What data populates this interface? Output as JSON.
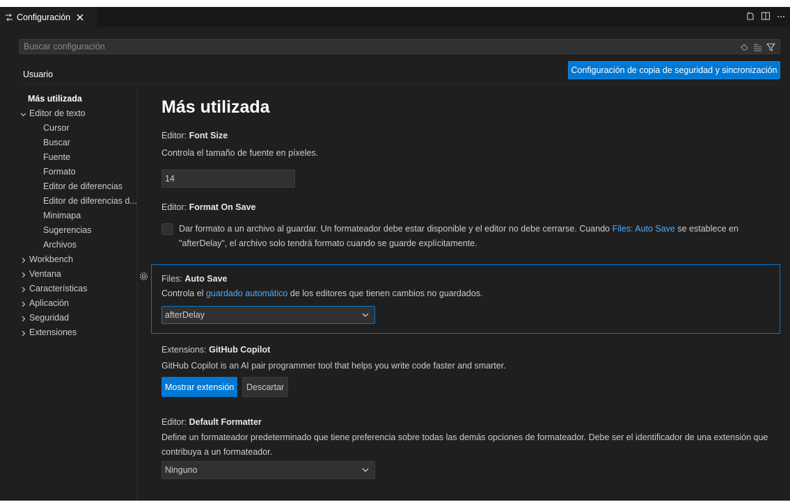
{
  "tab": {
    "title": "Configuración"
  },
  "search": {
    "placeholder": "Buscar configuración"
  },
  "scope": {
    "user": "Usuario",
    "sync_button": "Configuración de copia de seguridad y sincronización"
  },
  "toc": {
    "items": [
      {
        "label": "Más utilizada",
        "level": 0
      },
      {
        "label": "Editor de texto",
        "level": 1,
        "expanded": true
      },
      {
        "label": "Cursor",
        "level": 2
      },
      {
        "label": "Buscar",
        "level": 2
      },
      {
        "label": "Fuente",
        "level": 2
      },
      {
        "label": "Formato",
        "level": 2
      },
      {
        "label": "Editor de diferencias",
        "level": 2
      },
      {
        "label": "Editor de diferencias d...",
        "level": 2
      },
      {
        "label": "Minimapa",
        "level": 2
      },
      {
        "label": "Sugerencias",
        "level": 2
      },
      {
        "label": "Archivos",
        "level": 2
      },
      {
        "label": "Workbench",
        "level": 1,
        "expanded": false
      },
      {
        "label": "Ventana",
        "level": 1,
        "expanded": false
      },
      {
        "label": "Características",
        "level": 1,
        "expanded": false
      },
      {
        "label": "Aplicación",
        "level": 1,
        "expanded": false
      },
      {
        "label": "Seguridad",
        "level": 1,
        "expanded": false
      },
      {
        "label": "Extensiones",
        "level": 1,
        "expanded": false
      }
    ]
  },
  "main": {
    "heading": "Más utilizada",
    "font_size": {
      "category": "Editor: ",
      "name": "Font Size",
      "description": "Controla el tamaño de fuente en píxeles.",
      "value": "14"
    },
    "format_on_save": {
      "category": "Editor: ",
      "name": "Format On Save",
      "desc_1": "Dar formato a un archivo al guardar. Un formateador debe estar disponible y el editor no debe cerrarse. Cuando ",
      "desc_link": "Files: Auto Save",
      "desc_2": " se establece en",
      "desc_3": "\"afterDelay\", el archivo solo tendrá formato cuando se guarde explícitamente.",
      "checked": false
    },
    "auto_save": {
      "category": "Files: ",
      "name": "Auto Save",
      "desc_1": "Controla el ",
      "desc_link": "guardado automático",
      "desc_2": " de los editores que tienen cambios no guardados.",
      "value": "afterDelay"
    },
    "copilot": {
      "category": "Extensions: ",
      "name": "GitHub Copilot",
      "description": "GitHub Copilot is an AI pair programmer tool that helps you write code faster and smarter.",
      "primary_button": "Mostrar extensión",
      "secondary_button": "Descartar"
    },
    "default_formatter": {
      "category": "Editor: ",
      "name": "Default Formatter",
      "desc_1": "Define un formateador predeterminado que tiene preferencia sobre todas las demás opciones de formateador. Debe ser el identificador de una extensión que",
      "desc_2": "contribuya a un formateador.",
      "value": "Ninguno"
    }
  },
  "colors": {
    "accent": "#0078d4",
    "link": "#4daafc",
    "background": "#1f1f1f"
  }
}
